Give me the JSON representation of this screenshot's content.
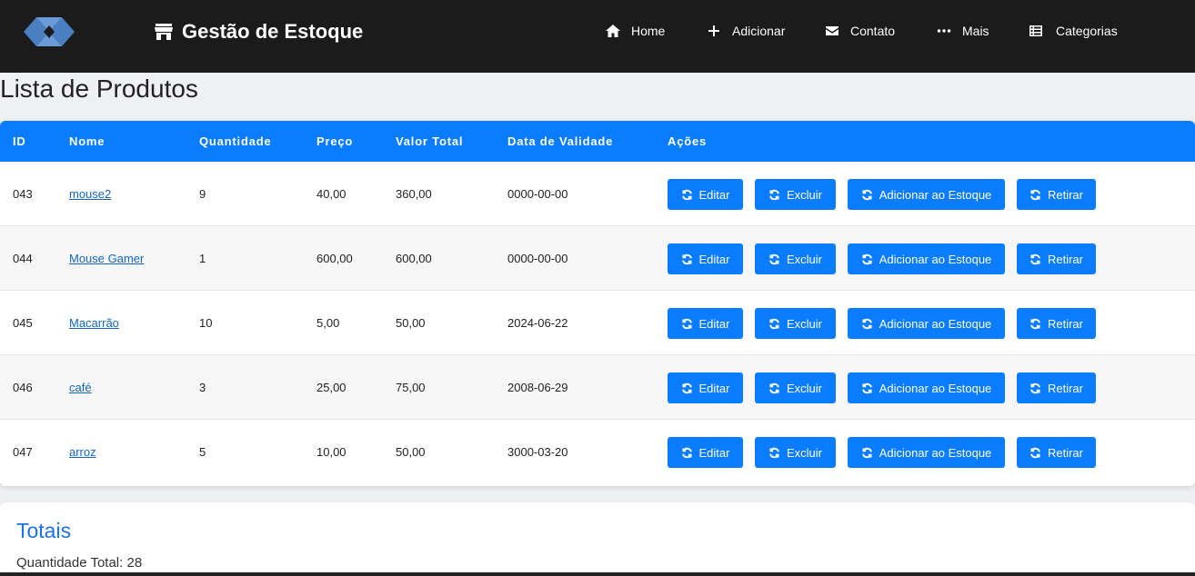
{
  "header": {
    "brand": "Gestão de Estoque",
    "nav": [
      {
        "label": "Home",
        "icon": "home-icon"
      },
      {
        "label": "Adicionar",
        "icon": "plus-icon"
      },
      {
        "label": "Contato",
        "icon": "envelope-icon"
      },
      {
        "label": "Mais",
        "icon": "ellipsis-icon"
      },
      {
        "label": "Categorias",
        "icon": "list-icon"
      }
    ]
  },
  "page_title": "Lista de Produtos",
  "table": {
    "columns": [
      "ID",
      "Nome",
      "Quantidade",
      "Preço",
      "Valor Total",
      "Data de Validade",
      "Ações"
    ],
    "actions": [
      "Editar",
      "Excluir",
      "Adicionar ao Estoque",
      "Retirar"
    ],
    "rows": [
      {
        "id": "043",
        "nome": "mouse2",
        "quantidade": "9",
        "preco": "40,00",
        "valor_total": "360,00",
        "validade": "0000-00-00"
      },
      {
        "id": "044",
        "nome": "Mouse Gamer",
        "quantidade": "1",
        "preco": "600,00",
        "valor_total": "600,00",
        "validade": "0000-00-00"
      },
      {
        "id": "045",
        "nome": "Macarrão",
        "quantidade": "10",
        "preco": "5,00",
        "valor_total": "50,00",
        "validade": "2024-06-22"
      },
      {
        "id": "046",
        "nome": "café",
        "quantidade": "3",
        "preco": "25,00",
        "valor_total": "75,00",
        "validade": "2008-06-29"
      },
      {
        "id": "047",
        "nome": "arroz",
        "quantidade": "5",
        "preco": "10,00",
        "valor_total": "50,00",
        "validade": "3000-03-20"
      }
    ]
  },
  "totals": {
    "title": "Totais",
    "quantidade_total": "Quantidade Total: 28"
  },
  "colors": {
    "navbar": "#1b1b1b",
    "primary": "#0a7cff",
    "link": "#1565c0",
    "totals_title": "#1a73e8"
  }
}
